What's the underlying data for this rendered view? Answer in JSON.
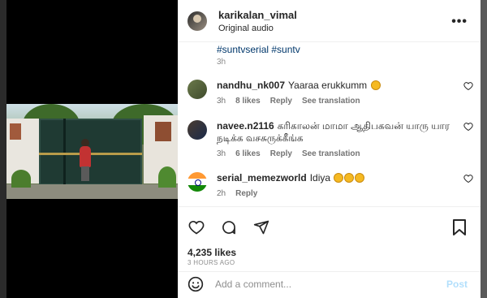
{
  "header": {
    "username": "karikalan_vimal",
    "subline": "Original audio",
    "more_label": "•••"
  },
  "caption": {
    "tags": "#suntvserial #suntv",
    "time": "3h"
  },
  "comments": [
    {
      "username": "nandhu_nk007",
      "text": "Yaaraa erukkumm",
      "emoji_count": 1,
      "time": "3h",
      "likes": "8 likes",
      "reply": "Reply",
      "translation": "See translation"
    },
    {
      "username": "navee.n2116",
      "text": "கரிகாலன் மாமா ஆதிபகவன் யாரு யார நடிக்க வசசுருக்கீங்க",
      "time": "3h",
      "likes": "6 likes",
      "reply": "Reply",
      "translation": "See translation"
    },
    {
      "username": "serial_memezworld",
      "text": "Idiya",
      "emoji_count": 3,
      "time": "2h",
      "reply": "Reply"
    }
  ],
  "actions": {
    "likes": "4,235 likes",
    "posted": "3 HOURS AGO",
    "comment_placeholder": "Add a comment...",
    "post_label": "Post"
  },
  "colors": {
    "link": "#00376b",
    "post_disabled": "#b2dffc",
    "text": "#262626",
    "muted": "#737373"
  }
}
